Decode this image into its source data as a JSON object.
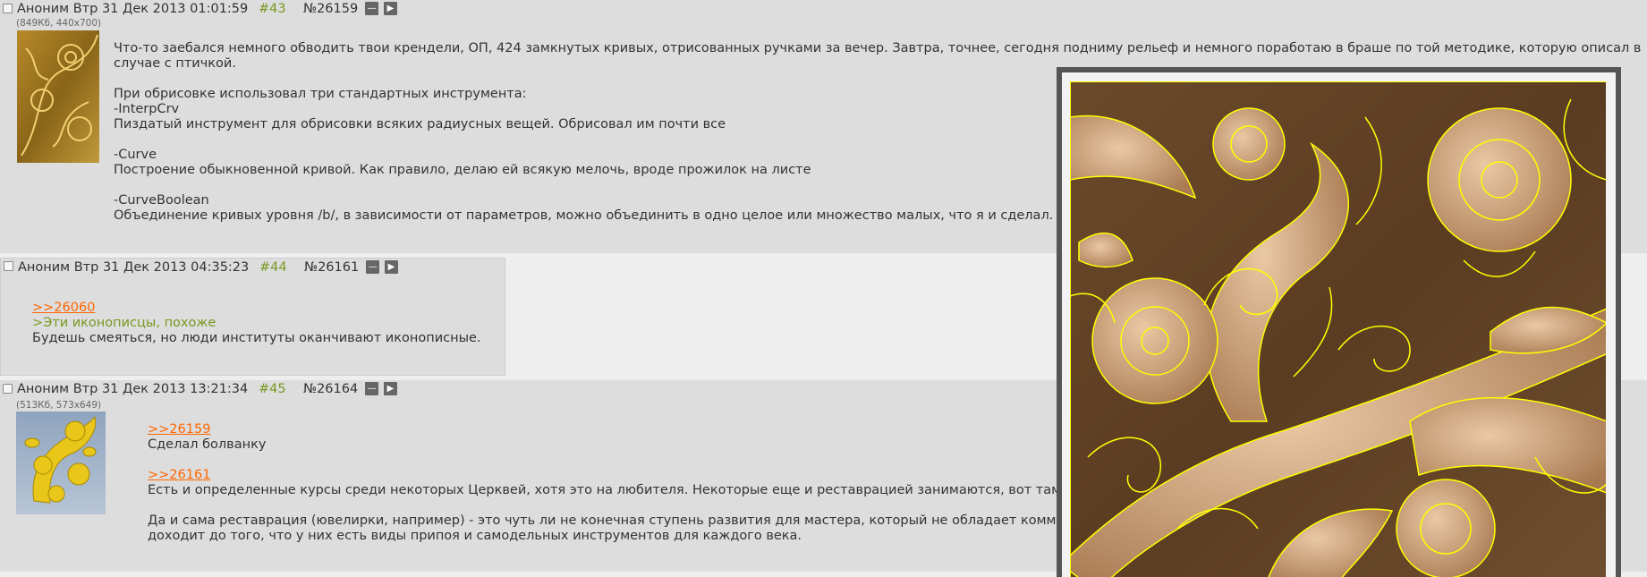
{
  "posts": [
    {
      "author": "Аноним",
      "date": "Втр 31 Дек 2013 01:01:59",
      "index": "#43",
      "number": "№26159",
      "file_info": "(849Кб, 440x700)",
      "lines": [
        "Что-то заебался немного обводить твои крендели, ОП, 424 замкнутых кривых, отрисованных ручками за вечер. Завтра, точнее, сегодня подниму рельеф и немного поработаю в браше по той методике, которую описал в",
        "случае с птичкой.",
        "При обрисовке использовал три стандартных инструмента:",
        "-InterpCrv",
        "Пиздатый инструмент для обрисовки всяких радиусных вещей. Обрисовал им почти все",
        "-Curve",
        "Построение обыкновенной кривой. Как правило, делаю ей всякую мелочь, вроде прожилок на листе",
        "-CurveBoolean",
        "Объединение кривых уровня /b/, в зависимости от параметров, можно объединить в одно целое или множество малых, что я и сделал."
      ]
    },
    {
      "author": "Аноним",
      "date": "Втр 31 Дек 2013 04:35:23",
      "index": "#44",
      "number": "№26161",
      "reply_link": ">>26060",
      "quote": ">Эти иконописцы, похоже",
      "text": "Будешь смеяться, но люди институты оканчивают иконописные."
    },
    {
      "author": "Аноним",
      "date": "Втр 31 Дек 2013 13:21:34",
      "index": "#45",
      "number": "№26164",
      "file_info": "(513Кб, 573x649)",
      "reply_link_1": ">>26159",
      "line_1": "Сделал болванку",
      "reply_link_2": ">>26161",
      "line_2": "Есть и определенные курсы среди некоторых Церквей, хотя это на любителя. Некоторые еще и реставрацией занимаются, вот там в",
      "line_3": "Да и сама реставрация (ювелирки, например) - это чуть ли не конечная ступень развития для мастера, который не обладает комме",
      "line_4": "доходит до того, что у них есть виды припоя и самодельных инструментов для каждого века."
    }
  ],
  "icons": {
    "hide_button": "minus-icon",
    "expand_button": "play-icon"
  },
  "colors": {
    "post_background": "#dddddd",
    "page_background": "#eeeeee",
    "post_index": "#789922",
    "reply_link": "#ff6600",
    "quote": "#789922",
    "curve_outline": "#ffff00"
  }
}
